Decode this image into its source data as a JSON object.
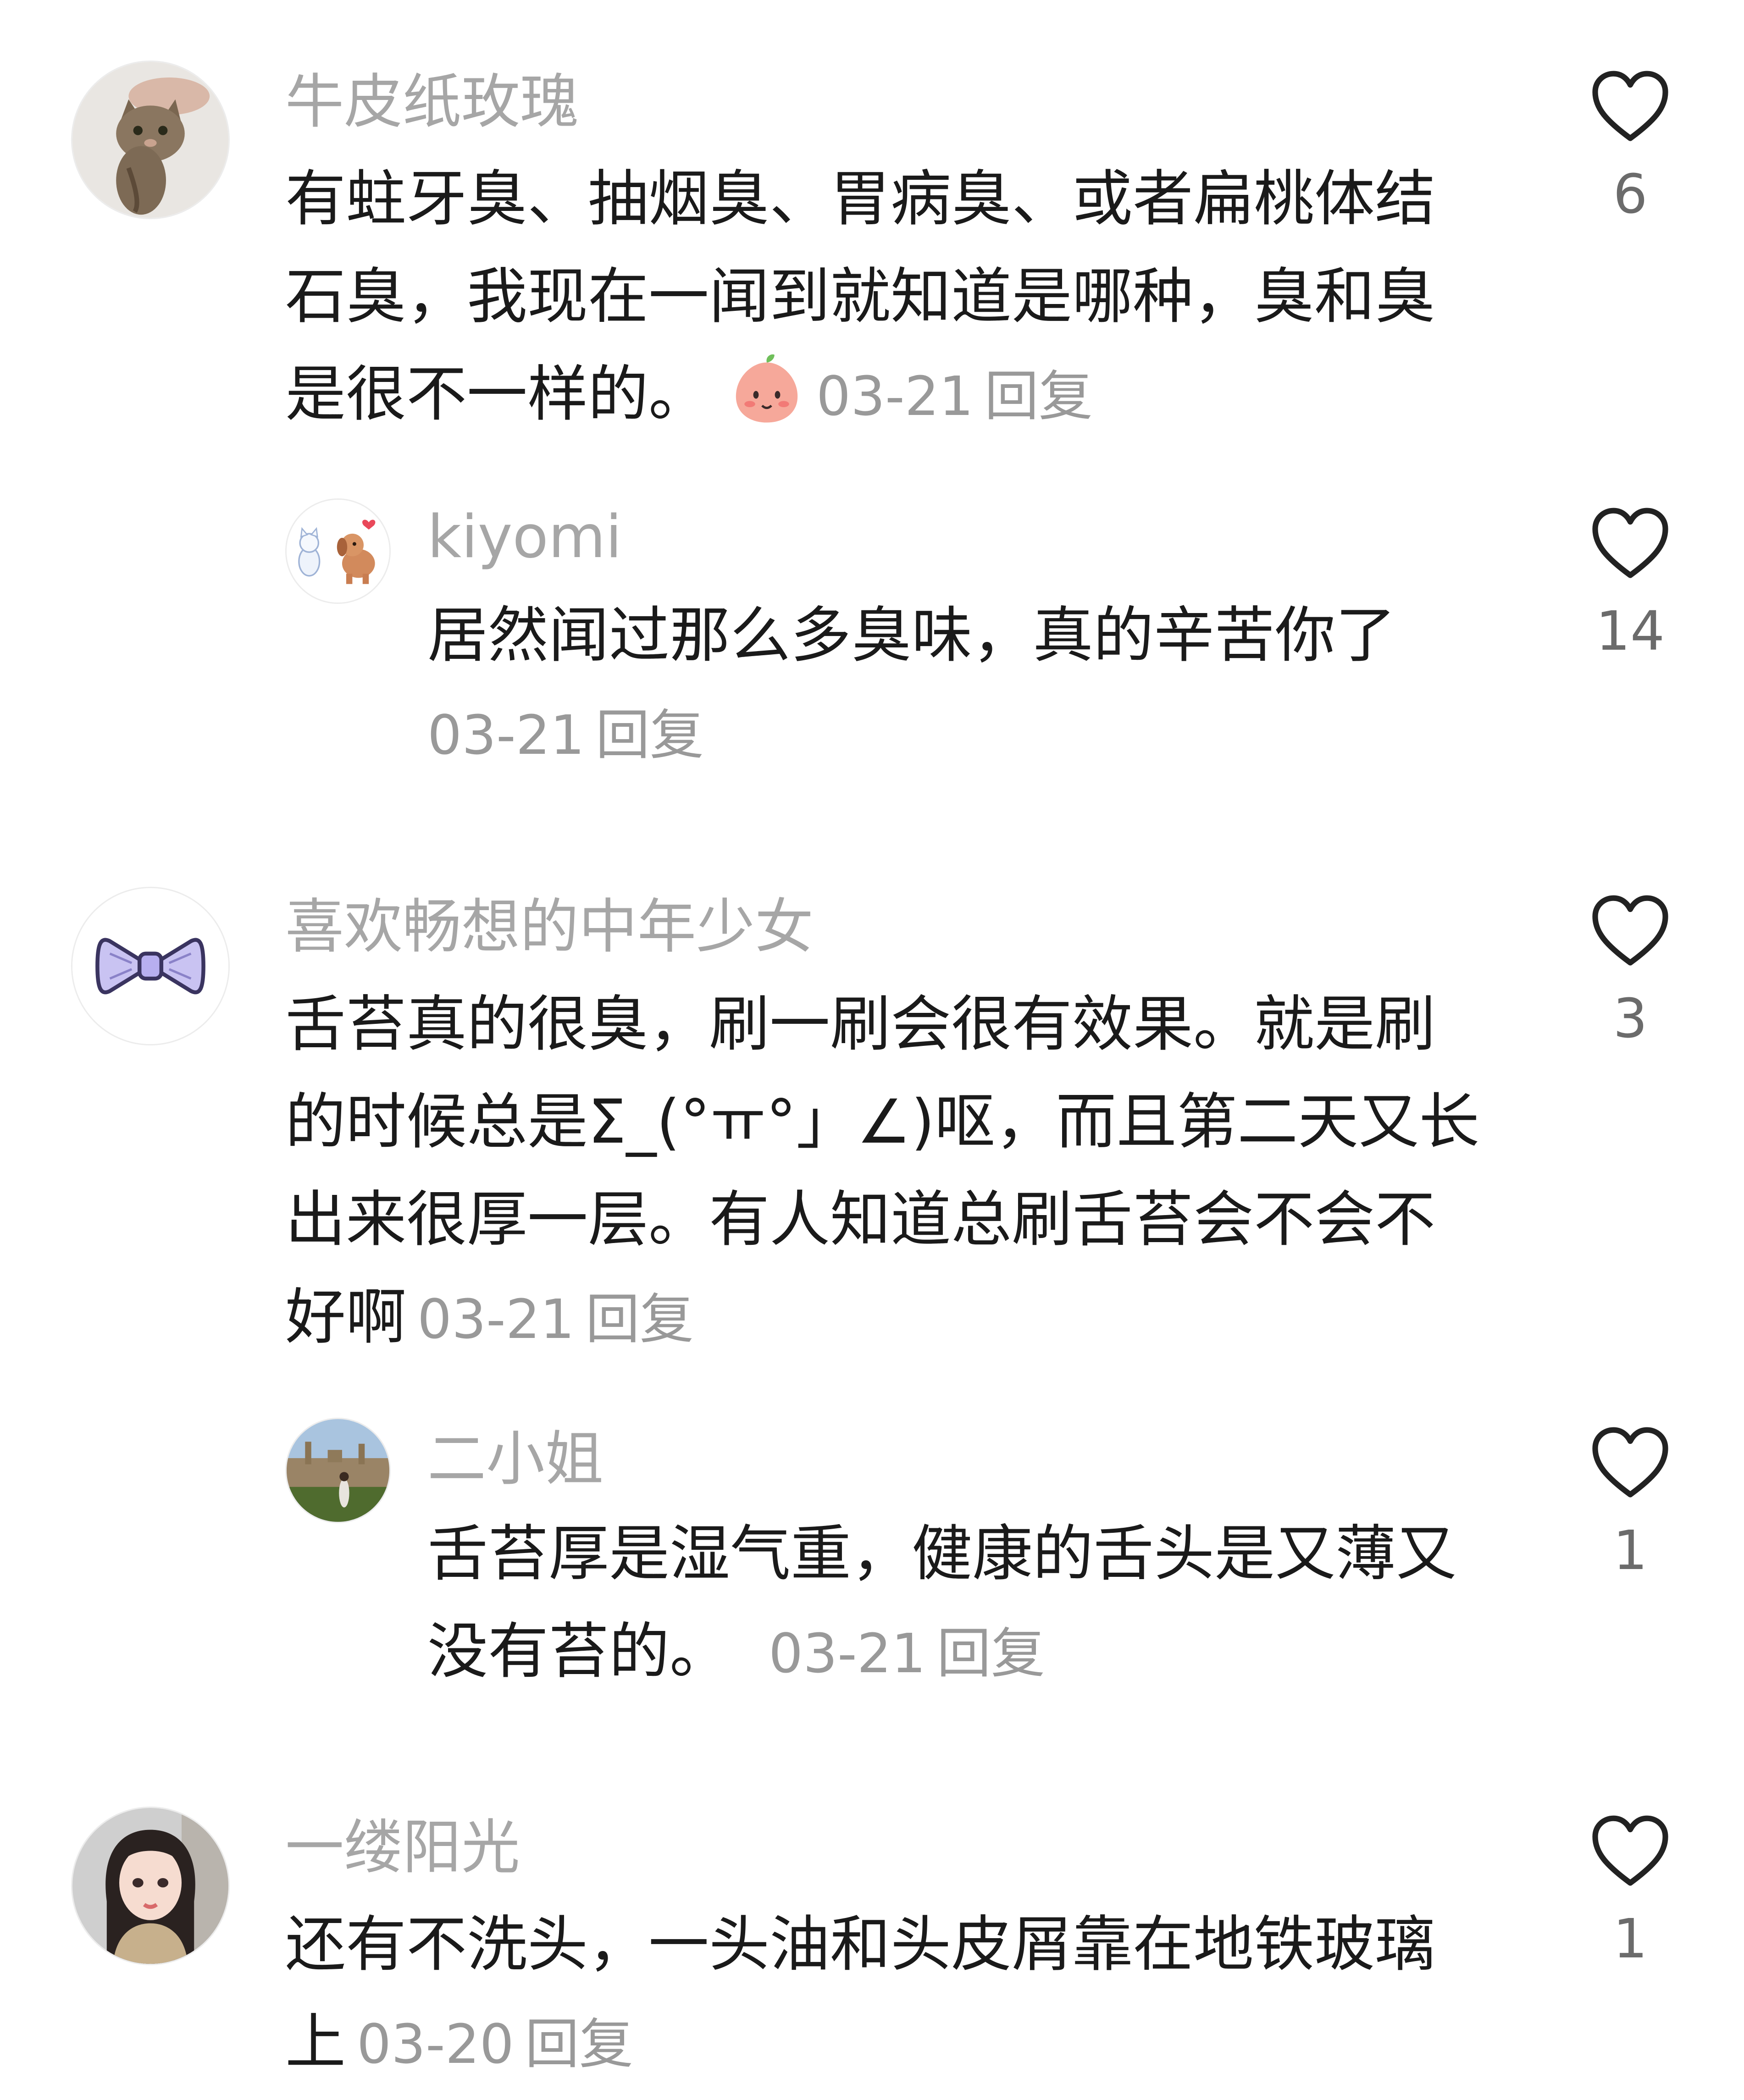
{
  "comments": [
    {
      "username": "牛皮纸玫瑰",
      "lines": [
        "有蛀牙臭、抽烟臭、胃病臭、或者扁桃体结",
        "石臭，我现在一闻到就知道是哪种，臭和臭",
        "是很不一样的。"
      ],
      "emoji": "peach-face-emoji",
      "date": "03-21",
      "reply_label": "回复",
      "likes": "6",
      "avatar_icon": "cat-avatar"
    },
    {
      "username": "kiyomi",
      "lines": [
        "居然闻过那么多臭味，真的辛苦你了"
      ],
      "date": "03-21",
      "reply_label": "回复",
      "likes": "14",
      "avatar_icon": "puppy-kitten-avatar"
    },
    {
      "username": "喜欢畅想的中年少女",
      "lines": [
        "舌苔真的很臭，刷一刷会很有效果。就是刷",
        "的时候总是Σ_(°ㅠ°」∠)呕，而且第二天又长",
        "出来很厚一层。有人知道总刷舌苔会不会不",
        "好啊"
      ],
      "date": "03-21",
      "reply_label": "回复",
      "likes": "3",
      "avatar_icon": "purple-bow-avatar"
    },
    {
      "username": "二小姐",
      "lines": [
        "舌苔厚是湿气重，健康的舌头是又薄又",
        "没有苔的。"
      ],
      "date": "03-21",
      "reply_label": "回复",
      "likes": "1",
      "avatar_icon": "campus-photo-avatar"
    },
    {
      "username": "一缕阳光",
      "lines": [
        "还有不洗头，一头油和头皮屑靠在地铁玻璃",
        "上"
      ],
      "date": "03-20",
      "reply_label": "回复",
      "likes": "1",
      "avatar_icon": "girl-portrait-avatar"
    }
  ],
  "colors": {
    "username": "#a6a6a6",
    "body_text": "#1a1a1a",
    "meta": "#999999",
    "like_count": "#6b6b6b",
    "heart_stroke": "#222222"
  }
}
